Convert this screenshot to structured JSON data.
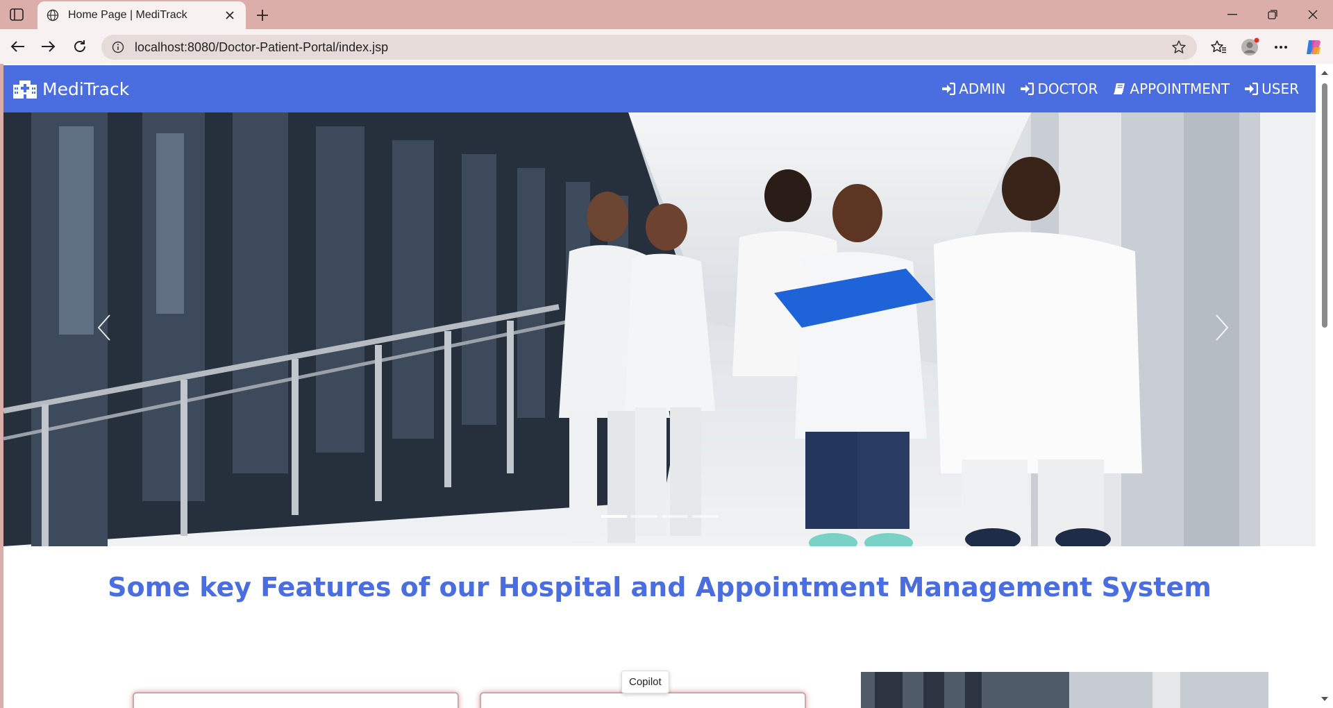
{
  "browser": {
    "tab_title": "Home Page | MediTrack",
    "url": "localhost:8080/Doctor-Patient-Portal/index.jsp",
    "tooltip": "Copilot"
  },
  "site": {
    "brand": "MediTrack",
    "nav": [
      {
        "label": "ADMIN",
        "icon": "sign-in-icon"
      },
      {
        "label": "DOCTOR",
        "icon": "sign-in-icon"
      },
      {
        "label": "APPOINTMENT",
        "icon": "book-icon"
      },
      {
        "label": "USER",
        "icon": "sign-in-icon"
      }
    ],
    "carousel": {
      "slides": 4,
      "active": 0
    },
    "features_heading": "Some key Features of our Hospital and Appointment Management System"
  },
  "colors": {
    "navbar": "#4a6de0",
    "heading": "#4a6de0",
    "chrome": "#dcaeaa"
  }
}
